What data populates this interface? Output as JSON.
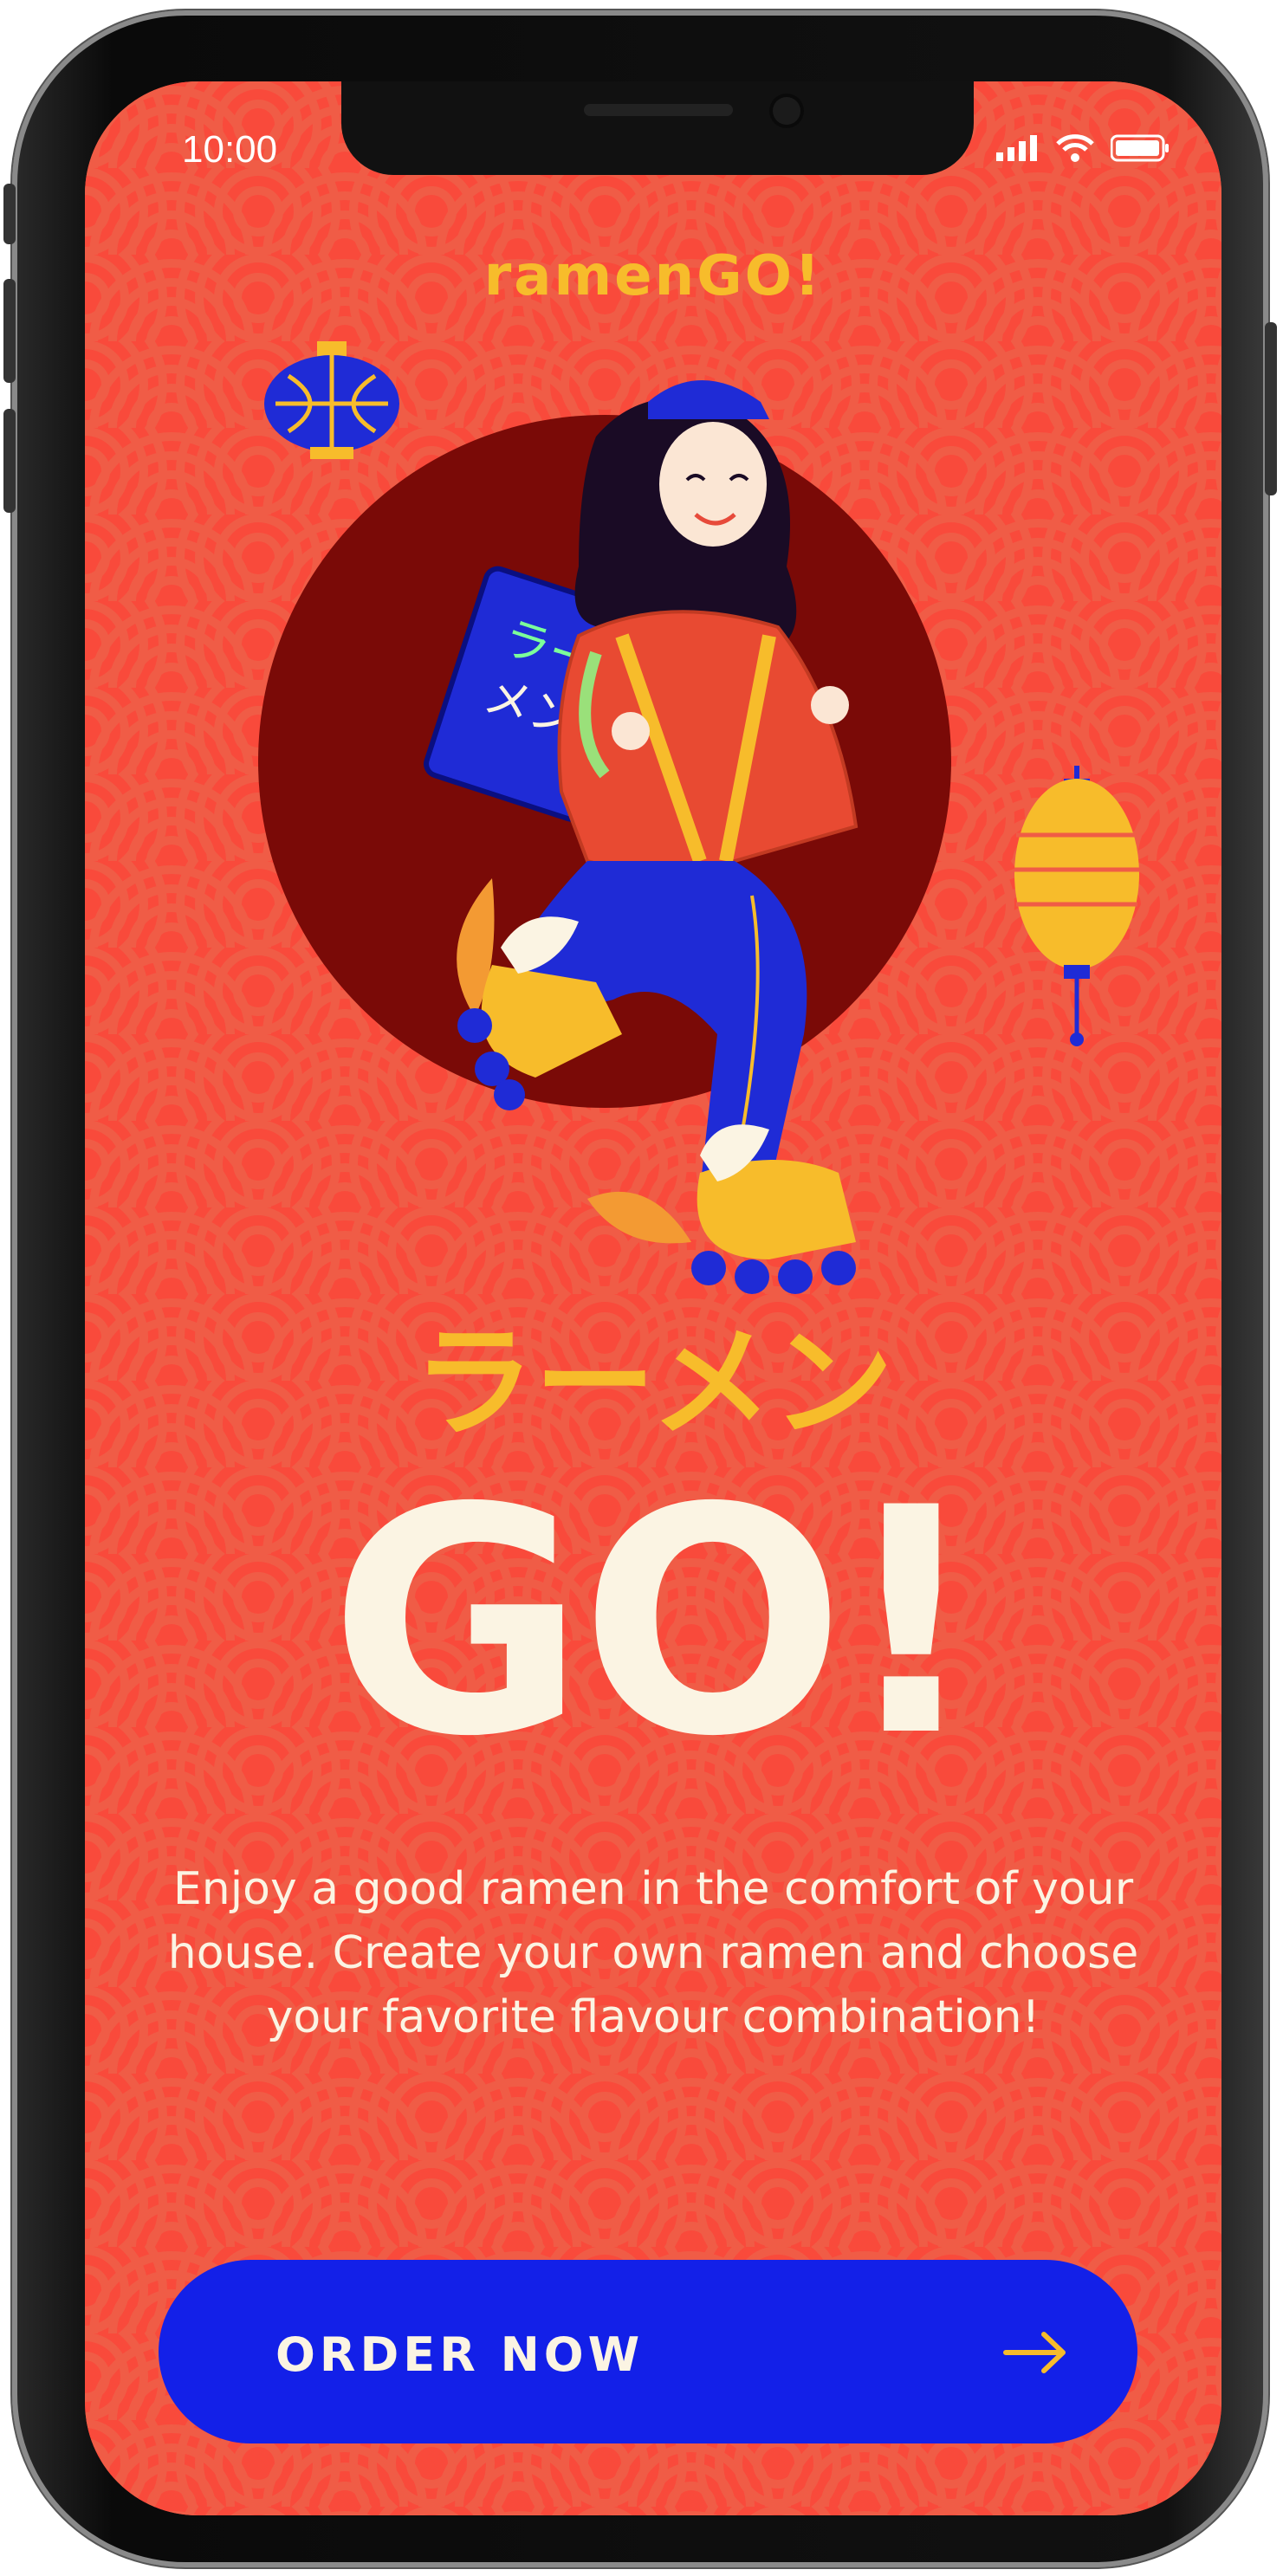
{
  "status_bar": {
    "time": "10:00",
    "icons": [
      "signal-icon",
      "wifi-icon",
      "battery-icon"
    ]
  },
  "app": {
    "brand": "ramenGO!",
    "katakana": "ラーメン",
    "headline": "GO!",
    "description": "Enjoy a good ramen in the comfort of your house. Create your own ramen and choose your favorite flavour combination!"
  },
  "cta": {
    "label": "ORDER NOW",
    "icon": "arrow-right-icon"
  },
  "colors": {
    "background": "#f94a3b",
    "accent_yellow": "#f7bc2b",
    "button_blue": "#1320e8",
    "cream": "#fbf4e3",
    "circle": "#7a0a07"
  },
  "illustration": {
    "description_icon": "ramen-skater-illustration",
    "backpack_text": "ラーメン"
  }
}
